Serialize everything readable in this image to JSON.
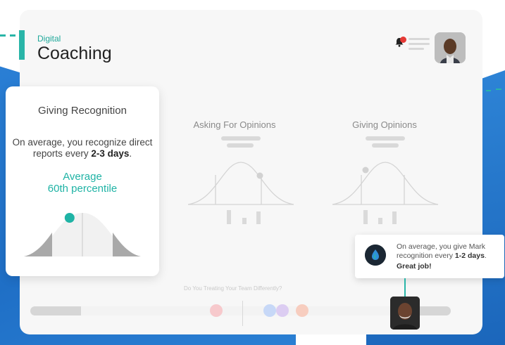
{
  "header": {
    "subtitle": "Digital",
    "title": "Coaching"
  },
  "icons": {
    "bell": "bell-icon",
    "menu": "menu-lines-icon",
    "tooltip_logo": "drop-logo-icon"
  },
  "colors": {
    "accent": "#29b5a8",
    "background_blue": "#1f6fc6",
    "notification": "#e53935",
    "card": "#f7f7f7"
  },
  "focus_card": {
    "title": "Giving Recognition",
    "desc_prefix": "On average, you recognize direct reports every ",
    "desc_bold": "2-3 days",
    "desc_suffix": ".",
    "average_label": "Average",
    "percentile_label": "60th percentile",
    "percentile": 60
  },
  "metrics": [
    {
      "title": "Asking For Opinions",
      "marker_fraction": 0.62
    },
    {
      "title": "Giving Opinions",
      "marker_fraction": 0.38
    }
  ],
  "footer": {
    "question": "Do You Treating Your Team Differently?"
  },
  "tooltip": {
    "prefix": "On average, you give Mark recognition every ",
    "bold": "1-2 days",
    "suffix": ".",
    "great": "Great job!"
  }
}
